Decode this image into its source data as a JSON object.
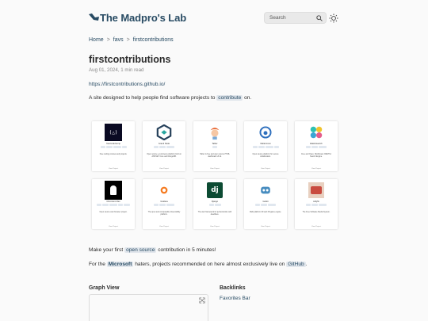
{
  "header": {
    "site_title": "The Madpro's Lab",
    "search_placeholder": "Search"
  },
  "breadcrumb": [
    "Home",
    "favs",
    "firstcontributions"
  ],
  "page": {
    "title": "firstcontributions",
    "meta": "Aug 01, 2024, 1 min read",
    "url": "https://firstcontributions.github.io/",
    "desc_before": "A site designed to help people find software projects to ",
    "desc_tag": "contribute",
    "desc_after": " on."
  },
  "cards": [
    {
      "name": "freeCodeCamp",
      "desc": "Free coding courses and projects.",
      "logo": "freecodecamp",
      "tags": 4
    },
    {
      "name": "Grand Node",
      "desc": "Open source e-commerce platform built on ASP.NET Core and MongoDB.",
      "logo": "grandnode",
      "tags": 3
    },
    {
      "name": "Tabler",
      "desc": "Tabler is free and open source HTML dashboard UI kit.",
      "logo": "tabler",
      "tags": 1
    },
    {
      "name": "Mattermost",
      "desc": "Open source platform for secure collaboration.",
      "logo": "mattermost",
      "tags": 4
    },
    {
      "name": "Elasticsearch",
      "desc": "Free and Open, Distributed, RESTful Search Engine.",
      "logo": "elastic",
      "tags": 3
    },
    {
      "name": "Chromium Dev",
      "desc": "Open source web browser project.",
      "logo": "chromium",
      "tags": 5
    },
    {
      "name": "Grafana",
      "desc": "The open and composable observability platform.",
      "logo": "grafana",
      "tags": 3
    },
    {
      "name": "Django",
      "desc": "The web framework for perfectionists with deadlines.",
      "logo": "django",
      "tags": 2
    },
    {
      "name": "Godot",
      "desc": "Multi-platform 2D and 3D game engine.",
      "logo": "godot",
      "tags": 3
    },
    {
      "name": "Jellyfin",
      "desc": "The Free Software Media System.",
      "logo": "jellyfin",
      "tags": 3
    }
  ],
  "card_footer": "View Project",
  "body": {
    "p1_before": "Make your first ",
    "p1_tag": "open source",
    "p1_after": " contribution in 5 minutes!",
    "p2_before": "For the ",
    "p2_tag1": "Microsoft",
    "p2_mid": " haters, projects recommended on here almost exclusively live on ",
    "p2_tag2": "GitHub",
    "p2_after": "."
  },
  "graph_view": {
    "title": "Graph View"
  },
  "backlinks": {
    "title": "Backlinks",
    "items": [
      "Favorites Bar"
    ]
  },
  "colors": {
    "accent": "#284b63",
    "tag_bg": "#e1e6ec"
  }
}
